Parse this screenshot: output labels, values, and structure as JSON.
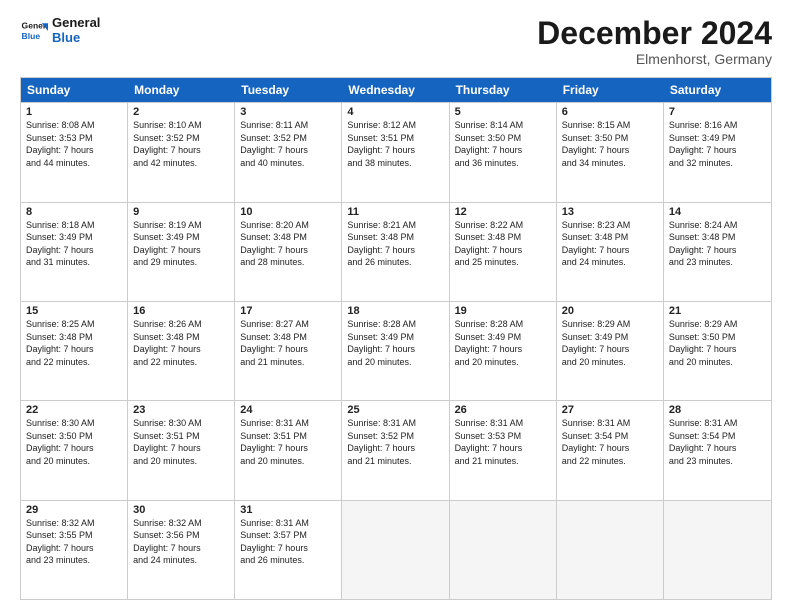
{
  "logo": {
    "line1": "General",
    "line2": "Blue"
  },
  "title": "December 2024",
  "location": "Elmenhorst, Germany",
  "days": [
    "Sunday",
    "Monday",
    "Tuesday",
    "Wednesday",
    "Thursday",
    "Friday",
    "Saturday"
  ],
  "rows": [
    [
      {
        "day": "1",
        "sunrise": "8:08 AM",
        "sunset": "3:53 PM",
        "daylight": "7 hours and 44 minutes."
      },
      {
        "day": "2",
        "sunrise": "8:10 AM",
        "sunset": "3:52 PM",
        "daylight": "7 hours and 42 minutes."
      },
      {
        "day": "3",
        "sunrise": "8:11 AM",
        "sunset": "3:52 PM",
        "daylight": "7 hours and 40 minutes."
      },
      {
        "day": "4",
        "sunrise": "8:12 AM",
        "sunset": "3:51 PM",
        "daylight": "7 hours and 38 minutes."
      },
      {
        "day": "5",
        "sunrise": "8:14 AM",
        "sunset": "3:50 PM",
        "daylight": "7 hours and 36 minutes."
      },
      {
        "day": "6",
        "sunrise": "8:15 AM",
        "sunset": "3:50 PM",
        "daylight": "7 hours and 34 minutes."
      },
      {
        "day": "7",
        "sunrise": "8:16 AM",
        "sunset": "3:49 PM",
        "daylight": "7 hours and 32 minutes."
      }
    ],
    [
      {
        "day": "8",
        "sunrise": "8:18 AM",
        "sunset": "3:49 PM",
        "daylight": "7 hours and 31 minutes."
      },
      {
        "day": "9",
        "sunrise": "8:19 AM",
        "sunset": "3:49 PM",
        "daylight": "7 hours and 29 minutes."
      },
      {
        "day": "10",
        "sunrise": "8:20 AM",
        "sunset": "3:48 PM",
        "daylight": "7 hours and 28 minutes."
      },
      {
        "day": "11",
        "sunrise": "8:21 AM",
        "sunset": "3:48 PM",
        "daylight": "7 hours and 26 minutes."
      },
      {
        "day": "12",
        "sunrise": "8:22 AM",
        "sunset": "3:48 PM",
        "daylight": "7 hours and 25 minutes."
      },
      {
        "day": "13",
        "sunrise": "8:23 AM",
        "sunset": "3:48 PM",
        "daylight": "7 hours and 24 minutes."
      },
      {
        "day": "14",
        "sunrise": "8:24 AM",
        "sunset": "3:48 PM",
        "daylight": "7 hours and 23 minutes."
      }
    ],
    [
      {
        "day": "15",
        "sunrise": "8:25 AM",
        "sunset": "3:48 PM",
        "daylight": "7 hours and 22 minutes."
      },
      {
        "day": "16",
        "sunrise": "8:26 AM",
        "sunset": "3:48 PM",
        "daylight": "7 hours and 22 minutes."
      },
      {
        "day": "17",
        "sunrise": "8:27 AM",
        "sunset": "3:48 PM",
        "daylight": "7 hours and 21 minutes."
      },
      {
        "day": "18",
        "sunrise": "8:28 AM",
        "sunset": "3:49 PM",
        "daylight": "7 hours and 20 minutes."
      },
      {
        "day": "19",
        "sunrise": "8:28 AM",
        "sunset": "3:49 PM",
        "daylight": "7 hours and 20 minutes."
      },
      {
        "day": "20",
        "sunrise": "8:29 AM",
        "sunset": "3:49 PM",
        "daylight": "7 hours and 20 minutes."
      },
      {
        "day": "21",
        "sunrise": "8:29 AM",
        "sunset": "3:50 PM",
        "daylight": "7 hours and 20 minutes."
      }
    ],
    [
      {
        "day": "22",
        "sunrise": "8:30 AM",
        "sunset": "3:50 PM",
        "daylight": "7 hours and 20 minutes."
      },
      {
        "day": "23",
        "sunrise": "8:30 AM",
        "sunset": "3:51 PM",
        "daylight": "7 hours and 20 minutes."
      },
      {
        "day": "24",
        "sunrise": "8:31 AM",
        "sunset": "3:51 PM",
        "daylight": "7 hours and 20 minutes."
      },
      {
        "day": "25",
        "sunrise": "8:31 AM",
        "sunset": "3:52 PM",
        "daylight": "7 hours and 21 minutes."
      },
      {
        "day": "26",
        "sunrise": "8:31 AM",
        "sunset": "3:53 PM",
        "daylight": "7 hours and 21 minutes."
      },
      {
        "day": "27",
        "sunrise": "8:31 AM",
        "sunset": "3:54 PM",
        "daylight": "7 hours and 22 minutes."
      },
      {
        "day": "28",
        "sunrise": "8:31 AM",
        "sunset": "3:54 PM",
        "daylight": "7 hours and 23 minutes."
      }
    ],
    [
      {
        "day": "29",
        "sunrise": "8:32 AM",
        "sunset": "3:55 PM",
        "daylight": "7 hours and 23 minutes."
      },
      {
        "day": "30",
        "sunrise": "8:32 AM",
        "sunset": "3:56 PM",
        "daylight": "7 hours and 24 minutes."
      },
      {
        "day": "31",
        "sunrise": "8:31 AM",
        "sunset": "3:57 PM",
        "daylight": "7 hours and 26 minutes."
      },
      null,
      null,
      null,
      null
    ]
  ]
}
